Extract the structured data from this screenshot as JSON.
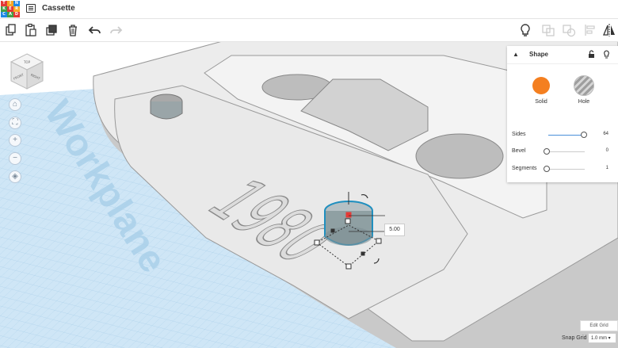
{
  "app": {
    "logo_letters": [
      "T",
      "I",
      "N",
      "K",
      "E",
      "R",
      "C",
      "A",
      "D"
    ],
    "logo_colors": [
      "#e53935",
      "#f9a825",
      "#1e88e5",
      "#43a047",
      "#e53935",
      "#f9a825",
      "#1e88e5",
      "#43a047",
      "#e53935"
    ],
    "doc_title": "Cassette"
  },
  "toolbar": {
    "left_tools": [
      "copy-icon",
      "paste-icon",
      "duplicate-icon",
      "delete-icon",
      "undo-icon",
      "redo-icon"
    ],
    "right_tools": [
      "light-bulb-icon",
      "group-icon",
      "ungroup-icon",
      "align-icon",
      "mirror-icon"
    ]
  },
  "viewcube": {
    "top": "TOP",
    "front": "FRONT",
    "right": "RIGHT"
  },
  "workplane_label": "Workplane",
  "model_text": "1980",
  "shape_panel": {
    "title": "Shape",
    "solid_label": "Solid",
    "hole_label": "Hole",
    "solid_color": "#f47f20",
    "properties": [
      {
        "label": "Sides",
        "value": "64",
        "level": 0.98
      },
      {
        "label": "Bevel",
        "value": "0",
        "level": 0.0
      },
      {
        "label": "Segments",
        "value": "1",
        "level": 0.0
      }
    ]
  },
  "dimension_value": "5.00",
  "edit_grid_label": "Edit Grid",
  "snap_grid_label": "Snap Grid",
  "snap_grid_value": "1.0 mm ▾"
}
